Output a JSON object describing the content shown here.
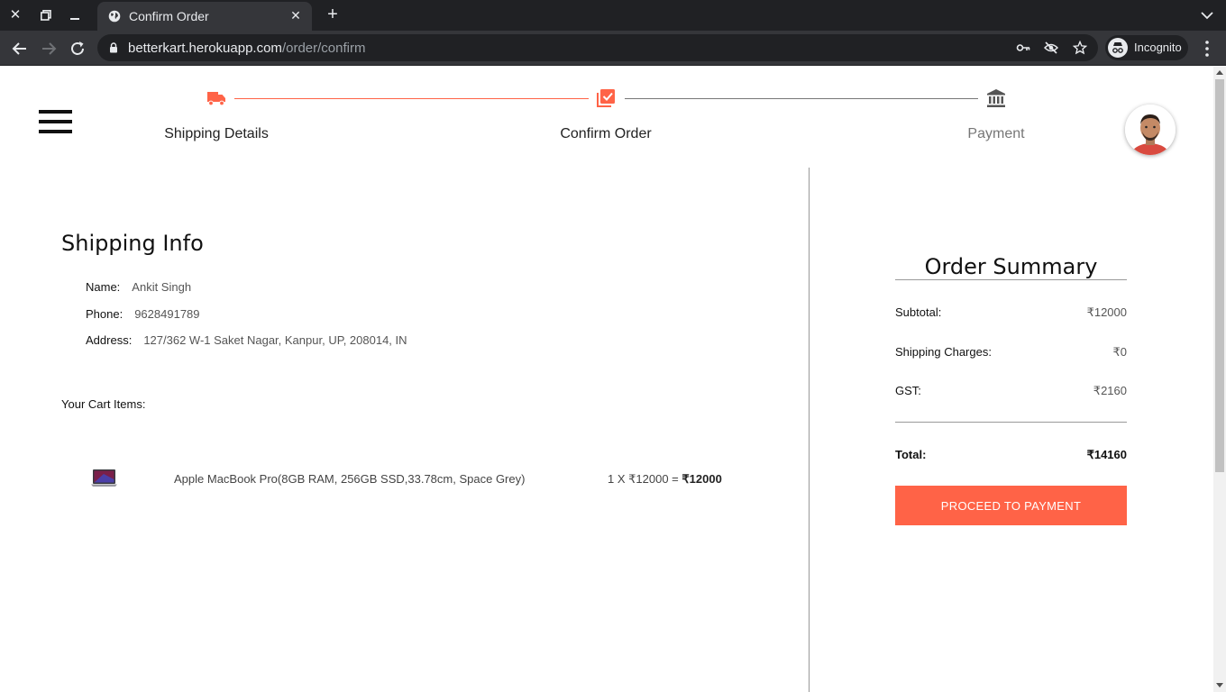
{
  "browser": {
    "tab_title": "Confirm Order",
    "url_host": "betterkart.herokuapp.com",
    "url_path": "/order/confirm",
    "profile_label": "Incognito"
  },
  "stepper": {
    "steps": [
      {
        "label": "Shipping Details",
        "icon": "truck-icon",
        "state": "complete"
      },
      {
        "label": "Confirm Order",
        "icon": "library-add-check-icon",
        "state": "active"
      },
      {
        "label": "Payment",
        "icon": "bank-icon",
        "state": "pending"
      }
    ],
    "active_color": "#ff6347",
    "inactive_color": "#555555"
  },
  "shipping": {
    "title": "Shipping Info",
    "name_label": "Name:",
    "name": "Ankit Singh",
    "phone_label": "Phone:",
    "phone": "9628491789",
    "address_label": "Address:",
    "address": "127/362 W-1 Saket Nagar, Kanpur, UP, 208014, IN"
  },
  "cart": {
    "title": "Your Cart Items:",
    "items": [
      {
        "name": "Apple MacBook Pro(8GB RAM, 256GB SSD,33.78cm, Space Grey)",
        "qty_price": "1 X ₹12000 = ",
        "total": "₹12000"
      }
    ]
  },
  "summary": {
    "title": "Order Summary",
    "subtotal_label": "Subtotal:",
    "subtotal": "₹12000",
    "shipping_label": "Shipping Charges:",
    "shipping": "₹0",
    "gst_label": "GST:",
    "gst": "₹2160",
    "total_label": "Total:",
    "total": "₹14160",
    "button_label": "PROCEED TO PAYMENT",
    "accent": "#ff6347"
  }
}
